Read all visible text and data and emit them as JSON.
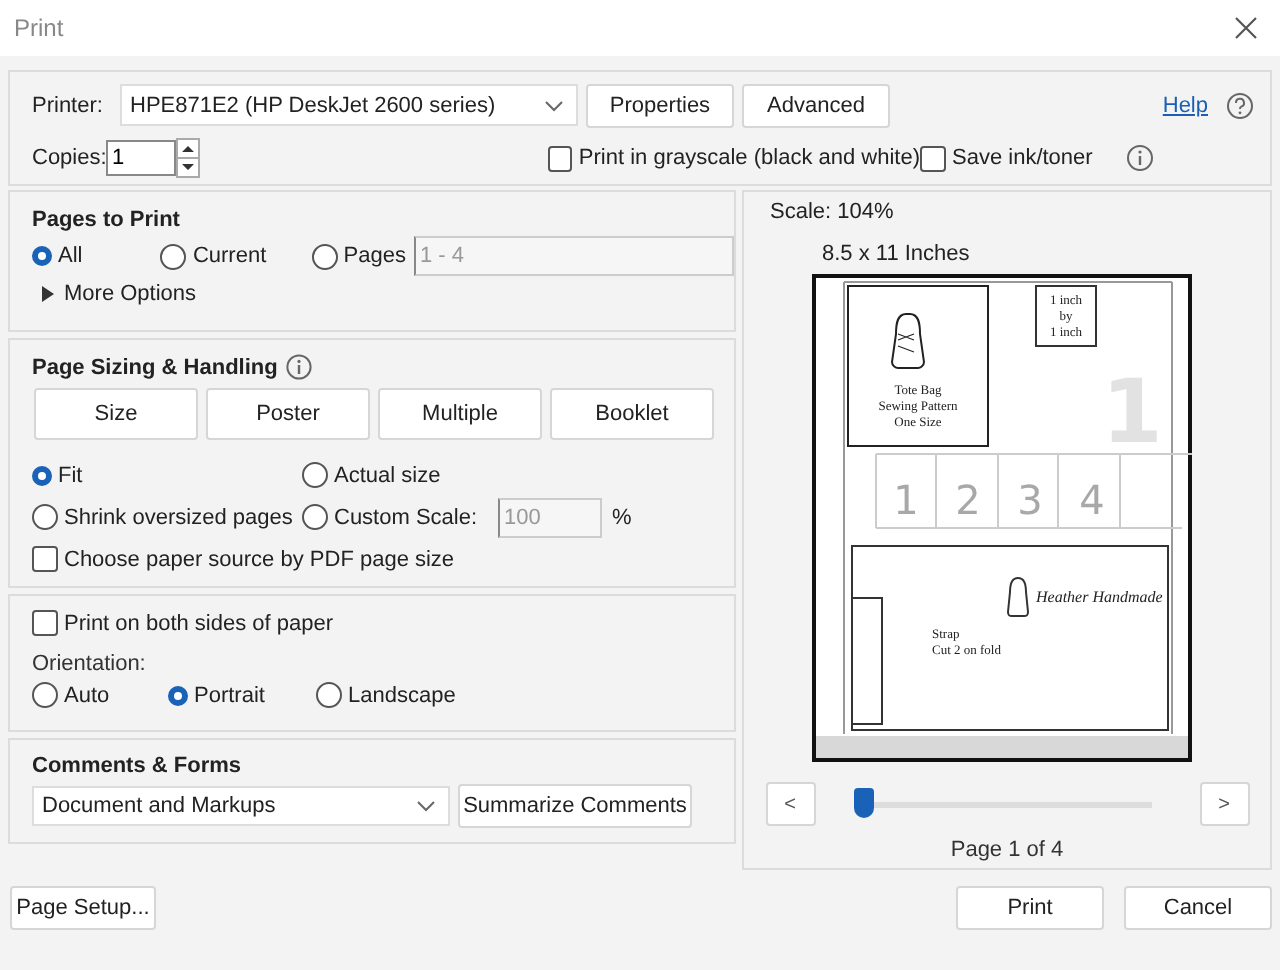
{
  "window": {
    "title": "Print"
  },
  "printer": {
    "label": "Printer:",
    "value": "HPE871E2 (HP DeskJet 2600 series)"
  },
  "top_buttons": [
    "Properties",
    "Advanced"
  ],
  "help": {
    "label": "Help"
  },
  "copies": {
    "label": "Copies:",
    "value": "1"
  },
  "options": [
    {
      "label": "Print in grayscale (black and white)",
      "checked": false
    },
    {
      "label": "Save ink/toner",
      "checked": false
    }
  ],
  "pages_to_print": {
    "title": "Pages to Print",
    "choices": [
      {
        "label": "All",
        "selected": true
      },
      {
        "label": "Current",
        "selected": false
      },
      {
        "label": "Pages",
        "selected": false
      }
    ],
    "range": "1 - 4",
    "more_options": "More Options"
  },
  "page_sizing": {
    "title": "Page Sizing & Handling",
    "modes": [
      "Size",
      "Poster",
      "Multiple",
      "Booklet"
    ],
    "choices": [
      {
        "label": "Fit",
        "selected": true
      },
      {
        "label": "Actual size",
        "selected": false
      },
      {
        "label": "Shrink oversized pages",
        "selected": false
      },
      {
        "label": "Custom Scale:",
        "selected": false
      }
    ],
    "custom_scale": "100",
    "unit": "%",
    "paper_source": {
      "label": "Choose paper source by PDF page size",
      "checked": false
    }
  },
  "duplex": {
    "label": "Print on both sides of paper",
    "checked": false
  },
  "orientation": {
    "label": "Orientation:",
    "choices": [
      {
        "label": "Auto",
        "selected": false
      },
      {
        "label": "Portrait",
        "selected": true
      },
      {
        "label": "Landscape",
        "selected": false
      }
    ]
  },
  "comments_forms": {
    "title": "Comments & Forms",
    "value": "Document and Markups",
    "button": "Summarize Comments"
  },
  "preview": {
    "scale": "Scale: 104%",
    "paper": "8.5 x 11 Inches",
    "document": {
      "page_number": "1",
      "cover": [
        "Tote Bag",
        "Sewing Pattern",
        "One Size"
      ],
      "scale_box": [
        "1 inch",
        "by",
        "1 inch"
      ],
      "tiles": [
        "1",
        "2",
        "3",
        "4"
      ],
      "brand": "Heather Handmade",
      "piece": [
        "Strap",
        "Cut 2 on fold"
      ]
    },
    "prev": "<",
    "next": ">",
    "slider": {
      "level": 0.02
    },
    "page_label": "Page 1 of 4"
  },
  "footer": {
    "page_setup": "Page Setup...",
    "buttons": [
      "Print",
      "Cancel"
    ]
  }
}
